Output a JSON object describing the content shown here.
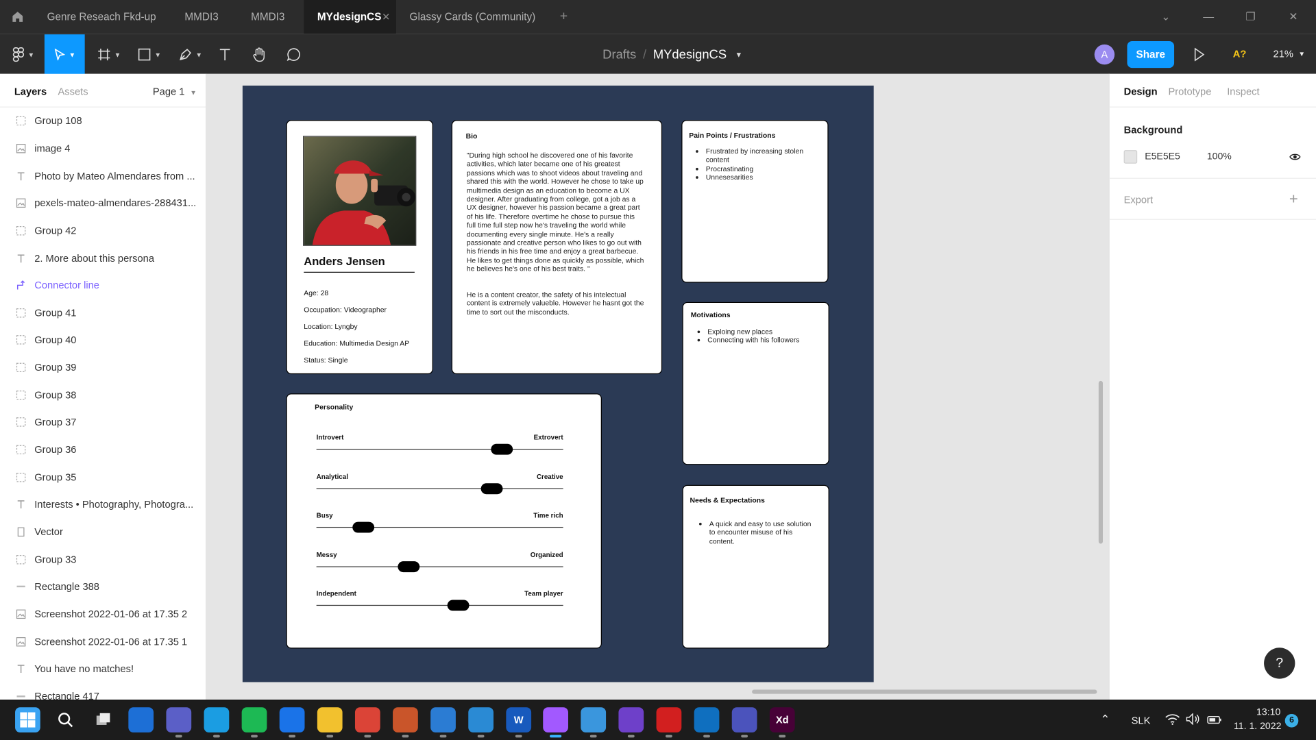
{
  "tabs": {
    "home_icon": "home-icon",
    "items": [
      {
        "label": "Genre Reseach Fkd-up",
        "active": false
      },
      {
        "label": "MMDI3",
        "active": false
      },
      {
        "label": "MMDI3",
        "active": false
      },
      {
        "label": "MYdesignCS",
        "active": true
      },
      {
        "label": "Glassy Cards (Community)",
        "active": false
      }
    ],
    "add_tab": "+"
  },
  "toolbar": {
    "breadcrumb_parent": "Drafts",
    "breadcrumb_sep": "/",
    "file_name": "MYdesignCS",
    "avatar_letter": "A",
    "share_label": "Share",
    "ai_label": "A?",
    "zoom": "21%",
    "accent": "#0d99ff"
  },
  "left_panel": {
    "tab_layers": "Layers",
    "tab_assets": "Assets",
    "page_selector": "Page 1",
    "layers": [
      {
        "icon": "group-icon",
        "label": "Group 108"
      },
      {
        "icon": "image-icon",
        "label": "image 4"
      },
      {
        "icon": "text-icon",
        "label": "Photo by Mateo Almendares from ..."
      },
      {
        "icon": "image-icon",
        "label": "pexels-mateo-almendares-288431..."
      },
      {
        "icon": "group-icon",
        "label": "Group 42"
      },
      {
        "icon": "text-icon",
        "label": "2. More about this persona"
      },
      {
        "icon": "connector-icon",
        "label": "Connector line"
      },
      {
        "icon": "group-icon",
        "label": "Group 41"
      },
      {
        "icon": "group-icon",
        "label": "Group 40"
      },
      {
        "icon": "group-icon",
        "label": "Group 39"
      },
      {
        "icon": "group-icon",
        "label": "Group 38"
      },
      {
        "icon": "group-icon",
        "label": "Group 37"
      },
      {
        "icon": "group-icon",
        "label": "Group 36"
      },
      {
        "icon": "group-icon",
        "label": "Group 35"
      },
      {
        "icon": "text-icon",
        "label": "Interests • Photography, Photogra..."
      },
      {
        "icon": "vector-icon",
        "label": "Vector"
      },
      {
        "icon": "group-icon",
        "label": "Group 33"
      },
      {
        "icon": "rectangle-icon",
        "label": "Rectangle 388"
      },
      {
        "icon": "image-icon",
        "label": "Screenshot 2022-01-06 at 17.35 2"
      },
      {
        "icon": "image-icon",
        "label": "Screenshot 2022-01-06 at 17.35 1"
      },
      {
        "icon": "text-icon",
        "label": "You have no matches!"
      },
      {
        "icon": "rectangle-icon",
        "label": "Rectangle 417"
      }
    ]
  },
  "right_panel": {
    "tab_design": "Design",
    "tab_prototype": "Prototype",
    "tab_inspect": "Inspect",
    "background_label": "Background",
    "background_hex": "E5E5E5",
    "background_opacity": "100%",
    "export_label": "Export",
    "help_label": "?"
  },
  "persona": {
    "name": "Anders Jensen",
    "details": [
      "Age: 28",
      "Occupation: Videographer",
      "Location: Lyngby",
      "Education: Multimedia Design AP",
      "Status: Single"
    ],
    "bio_title": "Bio",
    "bio_text": "\"During high school he discovered one of his favorite activities, which later became one of his greatest passions which was to shoot videos about traveling and shared this with the world. However he chose to take up multimedia design as an education to become a UX designer. After graduating from college, got a job as a UX designer, however his passion became a great part of his life. Therefore overtime he chose to pursue this full time full step now he's traveling the world while documenting every single minute. He's a really passionate and creative person who likes to go out with his friends in his free time and enjoy a great barbecue. He likes to get things done as quickly as possible, which he believes he's one of his best traits. \"",
    "bio_text2": "He is a content creator, the safety of his intelectual content is extremely valueble. However he hasnt got the time to sort out the misconducts.",
    "pain_title": "Pain Points / Frustrations",
    "pain_items": [
      "Frustrated by increasing stolen content",
      "Procrastinating",
      "Unnesesarities"
    ],
    "motivations_title": "Motivations",
    "motivations_items": [
      "Exploing new places",
      "Connecting with his followers"
    ],
    "needs_title": "Needs & Expectations",
    "needs_items": [
      "A quick and easy to use solution to encounter misuse of his content."
    ],
    "personality_title": "Personality",
    "personality": [
      {
        "left": "Introvert",
        "right": "Extrovert",
        "value": 0.75
      },
      {
        "left": "Analytical",
        "right": "Creative",
        "value": 0.71
      },
      {
        "left": "Busy",
        "right": "Time rich",
        "value": 0.19
      },
      {
        "left": "Messy",
        "right": "Organized",
        "value": 0.375
      },
      {
        "left": "Independent",
        "right": "Team player",
        "value": 0.575
      }
    ]
  },
  "taskbar": {
    "language": "SLK",
    "time": "13:10",
    "date": "11. 1. 2022",
    "notification_count": "6",
    "apps": [
      {
        "name": "start-button",
        "label": "",
        "color": "#2aa0f0"
      },
      {
        "name": "search-app",
        "label": "",
        "color": "#1c1c1c"
      },
      {
        "name": "task-view-app",
        "label": "",
        "color": "#1c1c1c"
      },
      {
        "name": "widgets-app",
        "label": "",
        "color": "#1d6fd6"
      },
      {
        "name": "teams-chat-app",
        "label": "",
        "color": "#5b5fc7"
      },
      {
        "name": "edge-app",
        "label": "",
        "color": "#1b9de2"
      },
      {
        "name": "spotify-app",
        "label": "",
        "color": "#1db954"
      },
      {
        "name": "mail-app",
        "label": "",
        "color": "#1a73e8"
      },
      {
        "name": "file-explorer-app",
        "label": "",
        "color": "#f2c12e"
      },
      {
        "name": "chrome-app",
        "label": "",
        "color": "#db4437"
      },
      {
        "name": "paint-app",
        "label": "",
        "color": "#c9552a"
      },
      {
        "name": "calendar-app",
        "label": "",
        "color": "#2b7cd3"
      },
      {
        "name": "photos-app",
        "label": "",
        "color": "#2a8ad4"
      },
      {
        "name": "word-app",
        "label": "W",
        "color": "#185abd"
      },
      {
        "name": "figma-app",
        "label": "",
        "color": "#a259ff"
      },
      {
        "name": "notepad-app",
        "label": "",
        "color": "#3a96dd"
      },
      {
        "name": "github-app",
        "label": "",
        "color": "#6e40c9"
      },
      {
        "name": "acrobat-app",
        "label": "",
        "color": "#d21f1f"
      },
      {
        "name": "vscode-app",
        "label": "",
        "color": "#0f6fbf"
      },
      {
        "name": "teams-app",
        "label": "",
        "color": "#4b53bc"
      },
      {
        "name": "xd-app",
        "label": "Xd",
        "color": "#470137"
      }
    ]
  }
}
